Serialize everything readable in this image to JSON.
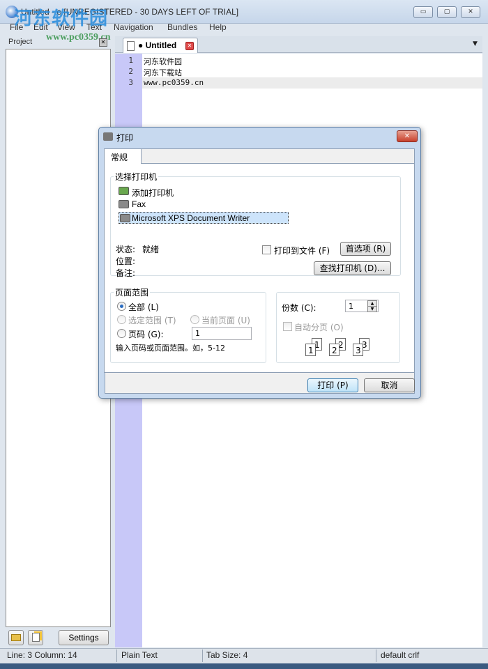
{
  "window": {
    "title": "Untitled - e [UNREGISTERED - 30 DAYS LEFT OF TRIAL]",
    "minimize": "▭",
    "maximize": "▢",
    "close": "✕"
  },
  "watermark": {
    "brand": "河东软件园",
    "url": "www.pc0359.cn"
  },
  "menu": {
    "items": [
      "File",
      "Edit",
      "View",
      "Text",
      "Navigation",
      "Bundles",
      "Help"
    ]
  },
  "project": {
    "header": "Project",
    "close": "✕",
    "settings_button": "Settings"
  },
  "editor": {
    "tab_label": "● Untitled",
    "tab_close": "✕",
    "dropdown": "▼",
    "line_numbers": [
      "1",
      "2",
      "3"
    ],
    "lines": [
      "河东软件园",
      "河东下载站",
      "www.pc0359.cn"
    ]
  },
  "statusbar": {
    "position": "Line: 3  Column: 14",
    "syntax": "Plain Text",
    "tab_size": "Tab Size: 4",
    "encoding": "default crlf"
  },
  "dialog": {
    "title": "打印",
    "close": "✕",
    "tab": "常规",
    "select_printer_label": "选择打印机",
    "printers": [
      "添加打印机",
      "Fax",
      "Microsoft XPS Document Writer"
    ],
    "selected_printer_index": 2,
    "status_label": "状态:",
    "status_value": "就绪",
    "location_label": "位置:",
    "comment_label": "备注:",
    "print_to_file": "打印到文件 (F)",
    "preferences_button": "首选项 (R)",
    "find_printer_button": "查找打印机 (D)...",
    "page_range_label": "页面范围",
    "range_all": "全部 (L)",
    "range_selection": "选定范围 (T)",
    "range_current": "当前页面 (U)",
    "range_pages": "页码 (G):",
    "pages_value": "1",
    "range_hint": "输入页码或页面范围。如，5-12",
    "copies_label": "份数 (C):",
    "copies_value": "1",
    "collate_label": "自动分页 (O)",
    "collate_pages": [
      "1",
      "1",
      "2",
      "2",
      "3",
      "3"
    ],
    "print_button": "打印 (P)",
    "cancel_button": "取消"
  }
}
